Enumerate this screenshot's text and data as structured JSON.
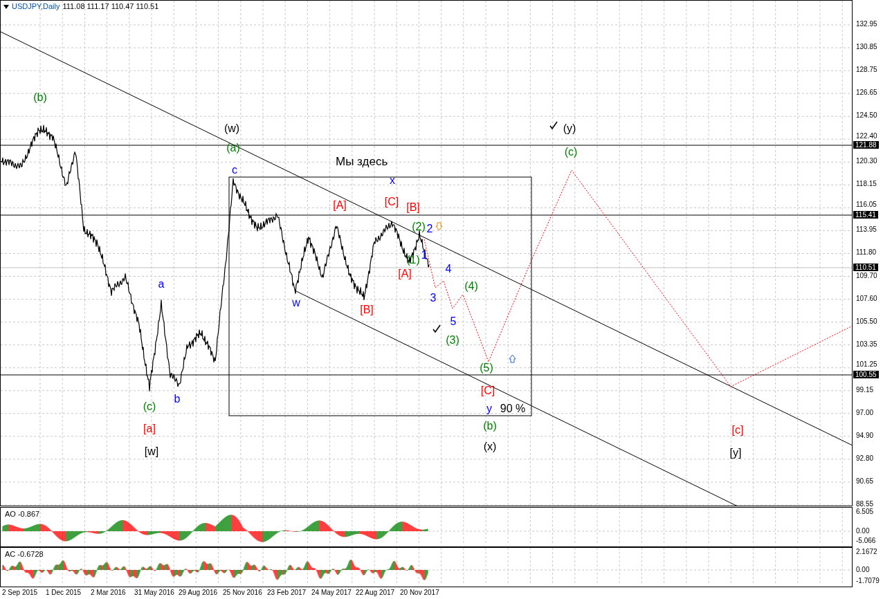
{
  "chart_header": {
    "symbol": "USDJPY,Daily",
    "ohlc": "111.08 111.17 110.47 110.51"
  },
  "price_axis": [
    "132.95",
    "130.85",
    "128.75",
    "126.65",
    "124.50",
    "122.40",
    "120.30",
    "118.15",
    "116.05",
    "113.95",
    "111.80",
    "109.70",
    "107.60",
    "105.50",
    "103.35",
    "101.25",
    "99.15",
    "97.00",
    "94.90",
    "92.80",
    "90.65",
    "88.55"
  ],
  "price_tags": [
    {
      "value": "121.88",
      "kind": "level"
    },
    {
      "value": "115.41",
      "kind": "level"
    },
    {
      "value": "110.51",
      "kind": "bid"
    },
    {
      "value": "100.55",
      "kind": "level"
    }
  ],
  "note": "Мы здесь",
  "wave_labels": [
    {
      "text": "(b)",
      "color": "#008000"
    },
    {
      "text": "(w)",
      "color": "#000000"
    },
    {
      "text": "(a)",
      "color": "#008000"
    },
    {
      "text": "c",
      "color": "#0000ff"
    },
    {
      "text": "x",
      "color": "#0000ff"
    },
    {
      "text": "[A]",
      "color": "#ff0000"
    },
    {
      "text": "[C]",
      "color": "#ff0000"
    },
    {
      "text": "[B]",
      "color": "#ff0000"
    },
    {
      "text": "(2)",
      "color": "#008000"
    },
    {
      "text": "2",
      "color": "#0000ff"
    },
    {
      "text": "(1)",
      "color": "#008000"
    },
    {
      "text": "1",
      "color": "#0000ff"
    },
    {
      "text": "[A]",
      "color": "#ff0000"
    },
    {
      "text": "a",
      "color": "#0000ff"
    },
    {
      "text": "w",
      "color": "#0000ff"
    },
    {
      "text": "[B]",
      "color": "#ff0000"
    },
    {
      "text": "4",
      "color": "#0000ff"
    },
    {
      "text": "(4)",
      "color": "#008000"
    },
    {
      "text": "3",
      "color": "#0000ff"
    },
    {
      "text": "5",
      "color": "#0000ff"
    },
    {
      "text": "(3)",
      "color": "#008000"
    },
    {
      "text": "(5)",
      "color": "#008000"
    },
    {
      "text": "[C]",
      "color": "#ff0000"
    },
    {
      "text": "y",
      "color": "#0000ff"
    },
    {
      "text": "90 %",
      "color": "#000000"
    },
    {
      "text": "(b)",
      "color": "#008000"
    },
    {
      "text": "(x)",
      "color": "#000000"
    },
    {
      "text": "(c)",
      "color": "#008000"
    },
    {
      "text": "b",
      "color": "#0000ff"
    },
    {
      "text": "[a]",
      "color": "#ff0000"
    },
    {
      "text": "[w]",
      "color": "#000000"
    },
    {
      "text": "(y)",
      "color": "#000000"
    },
    {
      "text": "(c)",
      "color": "#008000"
    },
    {
      "text": "[c]",
      "color": "#ff0000"
    },
    {
      "text": "[y]",
      "color": "#000000"
    }
  ],
  "indicators": [
    {
      "title": "AO -0.867",
      "max": "6.505",
      "zero": "0.00",
      "min": "-5.066"
    },
    {
      "title": "AC -0.6728",
      "max": "2.1672",
      "zero": "0.00",
      "min": "-1.7079"
    }
  ],
  "time_axis": [
    "2 Sep 2015",
    "1 Dec 2015",
    "2 Mar 2016",
    "31 May 2016",
    "29 Aug 2016",
    "25 Nov 2016",
    "23 Feb 2017",
    "24 May 2017",
    "22 Aug 2017",
    "20 Nov 2017"
  ]
}
